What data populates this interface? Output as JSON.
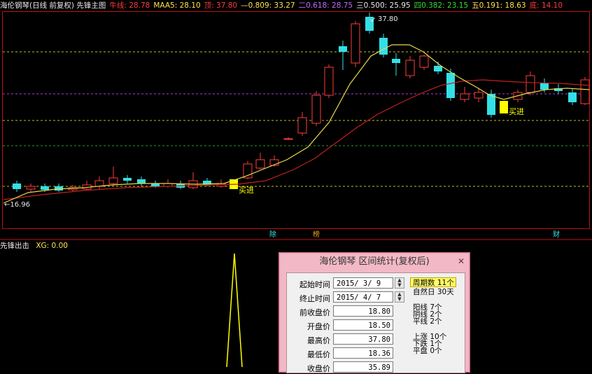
{
  "header": {
    "items": [
      {
        "text": "海伦钢琴(日线 前复权) 先锋主图",
        "color": "#e8e8e8"
      },
      {
        "text": "牛线: 28.78",
        "color": "#ff3b3b"
      },
      {
        "text": "MAA5: 28.10",
        "color": "#ffe14d"
      },
      {
        "text": "顶: 37.80",
        "color": "#ff3b3b"
      },
      {
        "text": "—0.809: 33.27",
        "color": "#ffe14d"
      },
      {
        "text": "二0.618: 28.75",
        "color": "#c06cff"
      },
      {
        "text": "三0.500: 25.95",
        "color": "#e8e8e8"
      },
      {
        "text": "四0.382: 23.15",
        "color": "#33dd33"
      },
      {
        "text": "五0.191: 18.63",
        "color": "#ffe14d"
      },
      {
        "text": "底: 14.10",
        "color": "#ff3b3b"
      }
    ]
  },
  "main_chart": {
    "price_high_label": "37.80",
    "price_low_label": "←16.96",
    "buy_label": "买进",
    "event_labels": [
      "除",
      "榜",
      "财"
    ]
  },
  "sub_chart": {
    "label": "先锋出击",
    "value_text": "XG: 0.00",
    "label_color": "#e8e8e8",
    "value_color": "#ffe14d"
  },
  "colors": {
    "up": "#ff3b3b",
    "down": "#33e0e6",
    "ma_yellow": "#e6d94a",
    "ma_red": "#c02020",
    "buy_marker": "#ffff00",
    "level_yellow": "#bfbf20",
    "level_purple": "#b040d0",
    "level_green": "#20a020"
  },
  "dialog": {
    "title": "海伦钢琴 区间统计(复权后)",
    "fields": [
      {
        "label": "起始时间",
        "value": "2015/ 3/ 9",
        "date": true
      },
      {
        "label": "终止时间",
        "value": "2015/ 4/ 7",
        "date": true
      },
      {
        "label": "前收盘价",
        "value": "18.80"
      },
      {
        "label": "开盘价",
        "value": "18.50"
      },
      {
        "label": "最高价",
        "value": "37.80"
      },
      {
        "label": "最低价",
        "value": "18.36"
      },
      {
        "label": "收盘价",
        "value": "35.89"
      }
    ],
    "period_count": "周期数 11个",
    "natural_days": "自然日 30天",
    "yang": "阳线 7个",
    "yin": "阴线 2个",
    "ping": "平线 2个",
    "up": "上涨 10个",
    "down": "下跌 1个",
    "flat": "平盘 0个"
  }
}
